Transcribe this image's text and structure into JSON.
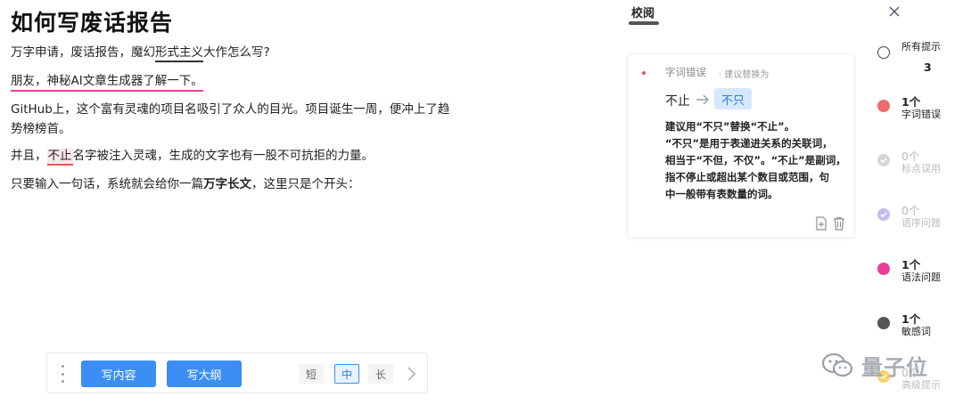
{
  "editor": {
    "title": "如何写废话报告",
    "p1": {
      "pre": "万字申请，废话报告，魔幻",
      "underlined": "形式主义",
      "post": "大作怎么写?"
    },
    "p2": {
      "text": "朋友，神秘AI文章生成器了解一下。"
    },
    "p3": {
      "text": "GitHub上，这个富有灵魂的项目名吸引了众人的目光。项目诞生一周，便冲上了趋势榜榜首。"
    },
    "p4": {
      "pre": "并且，",
      "error": "不止",
      "post": "名字被注入灵魂，生成的文字也有一股不可抗拒的力量。"
    },
    "p5": {
      "pre": "只要输入一句话，系统就会给你一篇",
      "bold": "万字长文",
      "post": "，这里只是个开头："
    }
  },
  "toolbar": {
    "write_content": "写内容",
    "write_outline": "写大纲",
    "length_short": "短",
    "length_medium": "中",
    "length_long": "长"
  },
  "panel": {
    "tab": "校阅",
    "card": {
      "type": "字词错误",
      "hint": "· 建议替换为",
      "from": "不止",
      "to": "不只",
      "line1_a": "建议用",
      "line1_b": "“不只”",
      "line1_c": "替换",
      "line1_d": "“不止”",
      "line1_e": "。",
      "line2_a": "“不只”",
      "line2_b": "是用于表递进关系的关联词，",
      "line3_a": "相当于“不但，不仅”。",
      "line3_b": "“不止”",
      "line3_c": "是副词，",
      "line4": "指不停止或超出某个数目或范围，句",
      "line5": "中一般带有表数量的词。"
    }
  },
  "sidebar": {
    "all": {
      "label": "所有提示",
      "count": "3"
    },
    "items": [
      {
        "count": "1个",
        "label": "字词错误",
        "color": "#ef6b6b"
      },
      {
        "count": "0个",
        "label": "标点误用",
        "color": "#d6d6d6"
      },
      {
        "count": "0个",
        "label": "语序问题",
        "color": "#c5b9f0"
      },
      {
        "count": "1个",
        "label": "语法问题",
        "color": "#e8409a"
      },
      {
        "count": "1个",
        "label": "敏感词",
        "color": "#555555"
      },
      {
        "count": "0个",
        "label": "高级提示",
        "color": "#f5d36a"
      }
    ]
  },
  "watermark": {
    "text": "量子位"
  },
  "colors": {
    "accent": "#3d8ef4",
    "error": "#e8535f",
    "grammar": "#e8409a"
  }
}
